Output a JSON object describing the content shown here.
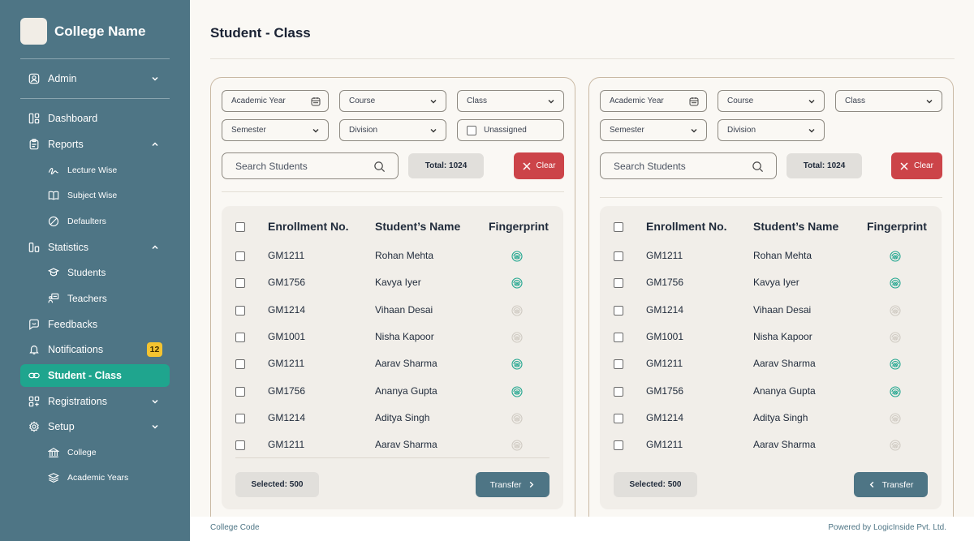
{
  "app": {
    "name": "College Name"
  },
  "sidebar": {
    "user": {
      "label": "Admin"
    },
    "items": [
      {
        "label": "Dashboard"
      },
      {
        "label": "Reports"
      },
      {
        "label": "Lecture Wise"
      },
      {
        "label": "Subject Wise"
      },
      {
        "label": "Defaulters"
      },
      {
        "label": "Statistics"
      },
      {
        "label": "Students"
      },
      {
        "label": "Teachers"
      },
      {
        "label": "Feedbacks"
      },
      {
        "label": "Notifications",
        "badge": "12"
      },
      {
        "label": "Student - Class"
      },
      {
        "label": "Registrations"
      },
      {
        "label": "Setup"
      },
      {
        "label": "College"
      },
      {
        "label": "Academic Years"
      }
    ],
    "active_item": "Student - Class"
  },
  "page": {
    "title": "Student - Class"
  },
  "filters": {
    "academic_year": "Academic Year",
    "course": "Course",
    "class": "Class",
    "semester": "Semester",
    "division": "Division",
    "unassigned": "Unassigned"
  },
  "search": {
    "placeholder": "Search Students"
  },
  "panels": {
    "left": {
      "total": "Total: 1024",
      "clear": "Clear",
      "selected": "Selected: 500",
      "transfer": "Transfer"
    },
    "right": {
      "total": "Total: 1024",
      "clear": "Clear",
      "selected": "Selected: 500",
      "transfer": "Transfer"
    }
  },
  "table": {
    "headers": {
      "enrollment": "Enrollment No.",
      "name": "Student’s Name",
      "fingerprint": "Fingerprint"
    },
    "rows": [
      {
        "enrollment": "GM1211",
        "name": "Rohan Mehta",
        "fingerprint": "registered"
      },
      {
        "enrollment": "GM1756",
        "name": "Kavya Iyer",
        "fingerprint": "registered"
      },
      {
        "enrollment": "GM1214",
        "name": "Vihaan Desai",
        "fingerprint": "not-registered"
      },
      {
        "enrollment": "GM1001",
        "name": "Nisha Kapoor",
        "fingerprint": "not-registered"
      },
      {
        "enrollment": "GM1211",
        "name": "Aarav Sharma",
        "fingerprint": "registered"
      },
      {
        "enrollment": "GM1756",
        "name": "Ananya Gupta",
        "fingerprint": "registered"
      },
      {
        "enrollment": "GM1214",
        "name": "Aditya Singh",
        "fingerprint": "not-registered"
      },
      {
        "enrollment": "GM1211",
        "name": "Aarav Sharma",
        "fingerprint": "not-registered"
      }
    ]
  },
  "footer": {
    "left": "College Code",
    "right": "Powered by LogicInside Pvt. Ltd."
  },
  "colors": {
    "sidebar": "#4e7585",
    "active": "#1fa58e",
    "clear": "#cc4449",
    "transfer": "#4e7585",
    "fingerprint_on": "#1fa58e",
    "fingerprint_off": "#cfcac2",
    "badge": "#f4c430"
  }
}
